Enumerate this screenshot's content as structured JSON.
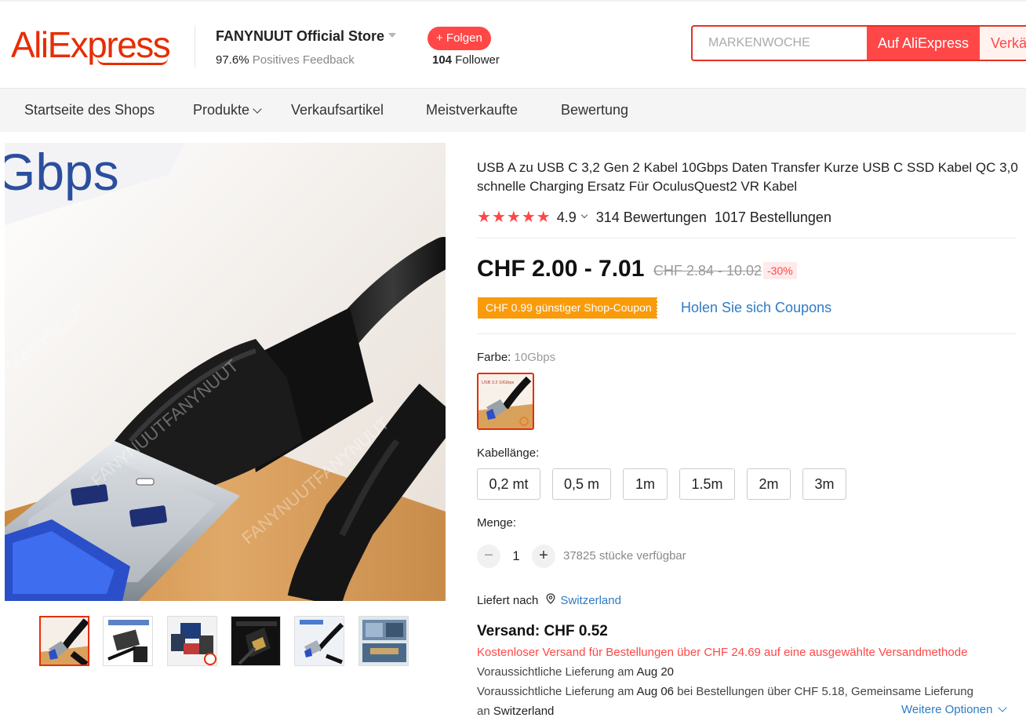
{
  "header": {
    "logo": "AliExpress",
    "store_name": "FANYNUUT Official Store",
    "feedback_value": "97.6%",
    "feedback_label": "Positives Feedback",
    "follow_label": "+ Folgen",
    "follower_count": "104",
    "follower_label": "Follower",
    "search_placeholder": "MARKENWOCHE",
    "search_aliexpress_label": "Auf AliExpress",
    "search_store_label": "Verkä"
  },
  "nav": {
    "items": [
      "Startseite des Shops",
      "Produkte",
      "Verkaufsartikel",
      "Meistverkaufte",
      "Bewertung"
    ]
  },
  "gallery": {
    "main_image_text": "Gbps",
    "watermark": "FANYNUUTFANYNUUT",
    "thumbnail_count": 6,
    "active_thumbnail": 0
  },
  "product": {
    "title": "USB A zu USB C 3,2 Gen 2 Kabel 10Gbps Daten Transfer Kurze USB C SSD Kabel QC 3,0 schnelle Charging Ersatz Für OculusQuest2 VR Kabel",
    "rating": "4.9",
    "stars": 5,
    "reviews": "314 Bewertungen",
    "orders": "1017 Bestellungen",
    "price": "CHF 2.00 - 7.01",
    "old_price": "CHF 2.84 - 10.02",
    "discount": "-30%",
    "coupon": "CHF 0.99 günstiger Shop-Coupon",
    "coupon_link": "Holen Sie sich Coupons",
    "color_label": "Farbe:",
    "color_value": "10Gbps",
    "swatch_text": "USB 3.2 10Gbps",
    "length_label": "Kabellänge:",
    "length_options": [
      "0,2 mt",
      "0,5 m",
      "1m",
      "1.5m",
      "2m",
      "3m"
    ],
    "quantity_label": "Menge:",
    "quantity": "1",
    "minus": "−",
    "plus": "+",
    "available": "37825 stücke verfügbar"
  },
  "shipping": {
    "deliver_to_label": "Liefert nach",
    "country": "Switzerland",
    "title": "Versand: CHF 0.52",
    "free_shipping": "Kostenloser Versand für Bestellungen über CHF 24.69 auf eine ausgewählte Versandmethode",
    "estimate1_prefix": "Voraussichtliche Lieferung am",
    "estimate1_date": "Aug 20",
    "estimate2_prefix": "Voraussichtliche Lieferung am",
    "estimate2_date": "Aug 06",
    "estimate2_suffix": "bei Bestellungen über CHF 5.18, Gemeinsame Lieferung",
    "estimate2_line2_prefix": "an",
    "estimate2_line2_country": "Switzerland",
    "more_options": "Weitere Optionen"
  },
  "colors": {
    "brand": "#e62e04",
    "accent": "#ff4747",
    "link": "#2e7bc4",
    "coupon": "#f99b0a"
  }
}
